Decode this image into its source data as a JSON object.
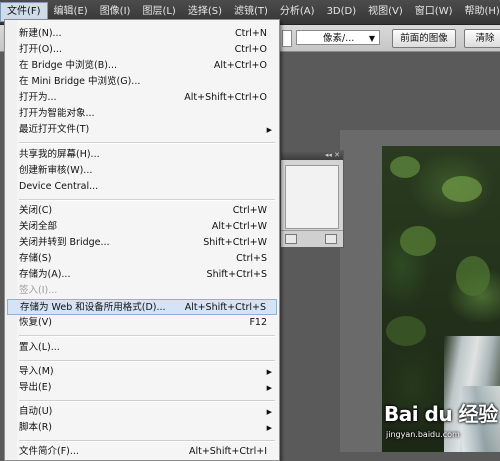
{
  "menubar": {
    "items": [
      "文件(F)",
      "编辑(E)",
      "图像(I)",
      "图层(L)",
      "选择(S)",
      "滤镜(T)",
      "分析(A)",
      "3D(D)",
      "视图(V)",
      "窗口(W)",
      "帮助(H)"
    ]
  },
  "options_bar": {
    "unit_select": "像素/...",
    "front_image_button": "前面的图像",
    "clear_button": "清除"
  },
  "file_menu": {
    "new": {
      "label": "新建(N)...",
      "shortcut": "Ctrl+N"
    },
    "open": {
      "label": "打开(O)...",
      "shortcut": "Ctrl+O"
    },
    "browse_bridge": {
      "label": "在 Bridge 中浏览(B)...",
      "shortcut": "Alt+Ctrl+O"
    },
    "browse_mini_bridge": {
      "label": "在 Mini Bridge 中浏览(G)..."
    },
    "open_as": {
      "label": "打开为...",
      "shortcut": "Alt+Shift+Ctrl+O"
    },
    "open_smart_object": {
      "label": "打开为智能对象..."
    },
    "recent_files": {
      "label": "最近打开文件(T)"
    },
    "share_screen": {
      "label": "共享我的屏幕(H)..."
    },
    "create_review": {
      "label": "创建新审核(W)..."
    },
    "device_central": {
      "label": "Device Central..."
    },
    "close": {
      "label": "关闭(C)",
      "shortcut": "Ctrl+W"
    },
    "close_all": {
      "label": "关闭全部",
      "shortcut": "Alt+Ctrl+W"
    },
    "close_goto_bridge": {
      "label": "关闭并转到 Bridge...",
      "shortcut": "Shift+Ctrl+W"
    },
    "save": {
      "label": "存储(S)",
      "shortcut": "Ctrl+S"
    },
    "save_as": {
      "label": "存储为(A)...",
      "shortcut": "Shift+Ctrl+S"
    },
    "check_in": {
      "label": "签入(I)..."
    },
    "save_for_web": {
      "label": "存储为 Web 和设备所用格式(D)...",
      "shortcut": "Alt+Shift+Ctrl+S"
    },
    "revert": {
      "label": "恢复(V)",
      "shortcut": "F12"
    },
    "place": {
      "label": "置入(L)..."
    },
    "import": {
      "label": "导入(M)"
    },
    "export": {
      "label": "导出(E)"
    },
    "automate": {
      "label": "自动(U)"
    },
    "scripts": {
      "label": "脚本(R)"
    },
    "file_info": {
      "label": "文件简介(F)...",
      "shortcut": "Alt+Shift+Ctrl+I"
    }
  },
  "watermark": {
    "brand": "Bai du 经验",
    "url": "jingyan.baidu.com"
  }
}
